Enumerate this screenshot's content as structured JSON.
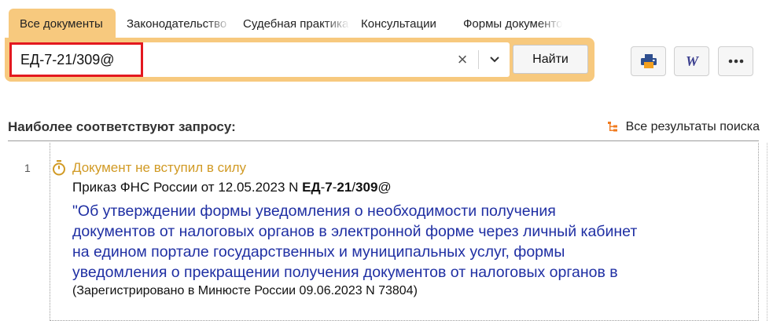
{
  "tabs": [
    {
      "label": "Все документы",
      "active": true
    },
    {
      "label": "Законодательство",
      "active": false
    },
    {
      "label": "Судебная практика",
      "active": false
    },
    {
      "label": "Консультации",
      "active": false
    },
    {
      "label": "Формы документов",
      "active": false
    }
  ],
  "search": {
    "value": "ЕД-7-21/309@",
    "clear_label": "×",
    "find_label": "Найти"
  },
  "toolbar": {
    "print_icon": "printer-icon",
    "word_icon": "word-icon",
    "more_label": "•••"
  },
  "results": {
    "heading": "Наиболее соответствуют запросу:",
    "all_results_label": "Все результаты поиска",
    "items": [
      {
        "number": "1",
        "status": "Документ не вступил в силу",
        "doc_prefix": "Приказ ФНС России от 12.05.2023 N ",
        "doc_number_parts": [
          "ЕД",
          "-",
          "7",
          "-",
          "21",
          "/",
          "309",
          "@"
        ],
        "title_lines": [
          "\"Об утверждении формы уведомления о необходимости получения",
          "документов от налоговых органов в электронной форме через личный кабинет",
          "на едином портале государственных и муниципальных услуг, формы",
          "уведомления о прекращении получения документов от налоговых органов в"
        ],
        "note": "(Зарегистрировано в Минюсте России 09.06.2023 N 73804)"
      }
    ]
  },
  "colors": {
    "accent": "#f7c97e",
    "highlight": "#e3181f",
    "link": "#1f2fa3",
    "status": "#d19a24"
  }
}
